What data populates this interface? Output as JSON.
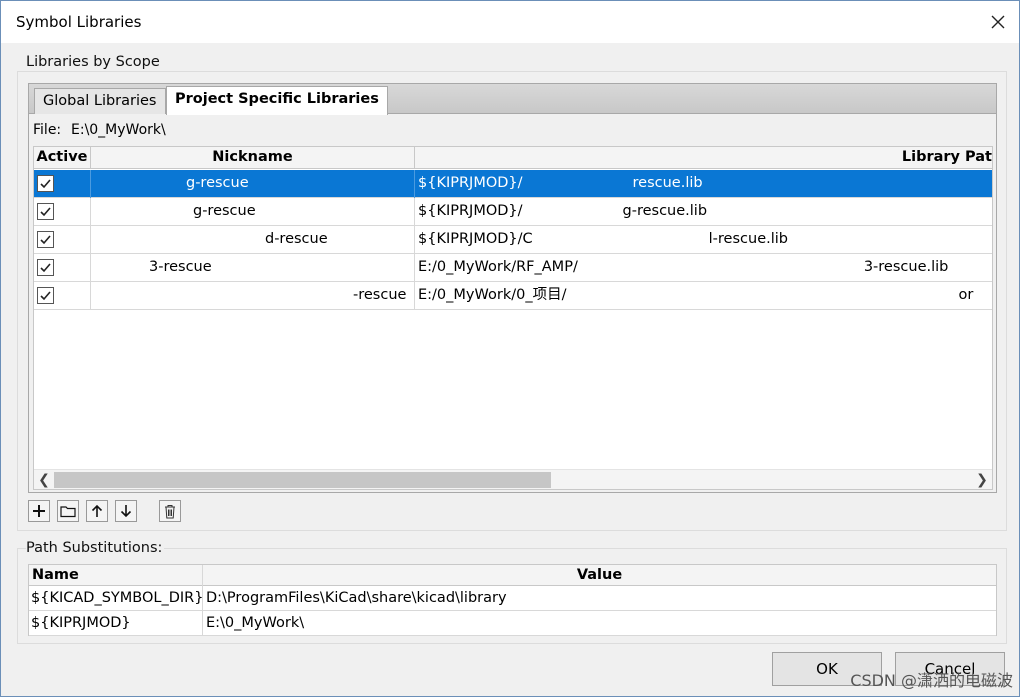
{
  "window": {
    "title": "Symbol Libraries"
  },
  "libraries_group": {
    "label": "Libraries by Scope"
  },
  "tabs": [
    {
      "label": "Global Libraries",
      "active": false
    },
    {
      "label": "Project Specific Libraries",
      "active": true
    }
  ],
  "file": {
    "label": "File:",
    "value": "E:\\0_MyWork\\"
  },
  "table": {
    "columns": [
      "Active",
      "Nickname",
      "Library Pat"
    ],
    "rows": [
      {
        "active": true,
        "nickname": "g-rescue",
        "path": "${KIPRJMOD}/",
        "path_tail": "rescue.lib",
        "selected": true
      },
      {
        "active": true,
        "nickname": "g-rescue",
        "path": "${KIPRJMOD}/",
        "path_tail": "g-rescue.lib",
        "selected": false
      },
      {
        "active": true,
        "nickname": "d-rescue",
        "path": "${KIPRJMOD}/C",
        "path_tail": "l-rescue.lib",
        "selected": false
      },
      {
        "active": true,
        "nickname": "3-rescue",
        "path": "E:/0_MyWork/RF_AMP/",
        "path_tail": "3-rescue.lib",
        "selected": false
      },
      {
        "active": true,
        "nickname": "-rescue",
        "path": "E:/0_MyWork/0_项目/",
        "path_tail": "or",
        "selected": false
      }
    ]
  },
  "toolbar": {
    "add": "add-library",
    "browse": "browse-library",
    "up": "move-up",
    "down": "move-down",
    "delete": "delete-library"
  },
  "path_substitutions": {
    "label": "Path Substitutions:",
    "columns": [
      "Name",
      "Value"
    ],
    "rows": [
      {
        "name": "${KICAD_SYMBOL_DIR}",
        "value": "D:\\ProgramFiles\\KiCad\\share\\kicad\\library"
      },
      {
        "name": "${KIPRJMOD}",
        "value": "E:\\0_MyWork\\"
      }
    ]
  },
  "buttons": {
    "ok": "OK",
    "cancel": "Cancel"
  },
  "watermark": "CSDN @潇洒的电磁波"
}
